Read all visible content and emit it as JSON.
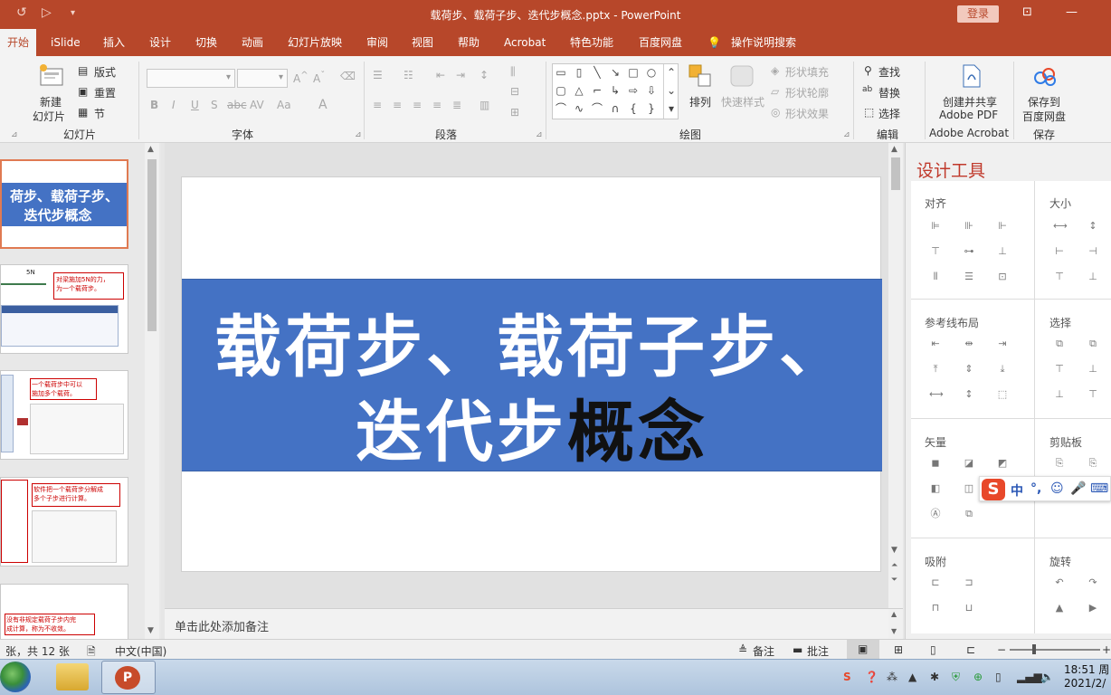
{
  "window": {
    "title": "载荷步、载荷子步、迭代步概念.pptx  -  PowerPoint",
    "login_label": "登录"
  },
  "tabs": [
    "开始",
    "iSlide",
    "插入",
    "设计",
    "切换",
    "动画",
    "幻灯片放映",
    "审阅",
    "视图",
    "帮助",
    "Acrobat",
    "特色功能",
    "百度网盘"
  ],
  "tell_me": "操作说明搜索",
  "ribbon": {
    "slides_group": {
      "label": "幻灯片",
      "new_slide": [
        "新建",
        "幻灯片"
      ],
      "layout": "版式",
      "reset": "重置",
      "section": "节"
    },
    "font_group": {
      "label": "字体"
    },
    "paragraph_group": {
      "label": "段落"
    },
    "drawing_group": {
      "label": "绘图",
      "arrange": "排列",
      "quick_styles": "快速样式",
      "shape_fill": "形状填充",
      "shape_outline": "形状轮廓",
      "shape_effects": "形状效果"
    },
    "editing_group": {
      "label": "编辑",
      "find": "查找",
      "replace": "替换",
      "select": "选择"
    },
    "acrobat_group": {
      "label": "Adobe Acrobat",
      "create_share": [
        "创建并共享",
        "Adobe PDF"
      ]
    },
    "save_group": {
      "label": "保存",
      "save_baidu": [
        "保存到",
        "百度网盘"
      ]
    }
  },
  "thumbnails": [
    {
      "title_lines": [
        "荷步、载荷子步、",
        "迭代步概念"
      ]
    },
    {
      "tag": "5N",
      "note": [
        "对梁施加5N的力，",
        "为一个载荷步。"
      ]
    },
    {
      "note": [
        "一个载荷步中可以",
        "施加多个载荷。"
      ]
    },
    {
      "note": [
        "软件把一个载荷步分解成",
        "多个子步进行计算。"
      ]
    },
    {
      "note": [
        "没有非规定载荷子步内完",
        "成计算，称为不收敛。"
      ]
    }
  ],
  "slide": {
    "title_line1": "载荷步、载荷子步、",
    "title_line2_white": "迭代步",
    "title_line2_dark": "概念",
    "band_color": "#4472c4"
  },
  "notes_placeholder": "单击此处添加备注",
  "design_pane": {
    "title": "设计工具",
    "sections": [
      "对齐",
      "大小",
      "参考线布局",
      "选择",
      "矢量",
      "剪贴板",
      "吸附",
      "旋转"
    ]
  },
  "ime": {
    "mode": "中"
  },
  "status": {
    "slide_count": "张，共 12 张",
    "language": "中文(中国)",
    "notes_btn": "备注",
    "comments_btn": "批注"
  },
  "taskbar": {
    "time": "18:51 周",
    "date": "2021/2/"
  },
  "colors": {
    "accent": "#b7472a",
    "thumb_selected_border": "#e07a52",
    "design_title": "#c0392b"
  }
}
